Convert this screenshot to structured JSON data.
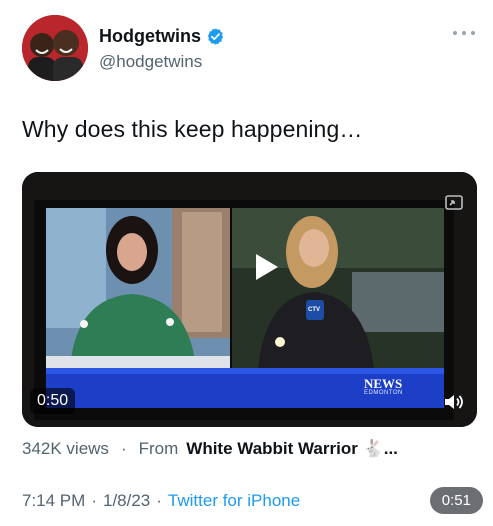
{
  "author": {
    "name": "Hodgetwins",
    "handle": "@hodgetwins",
    "verified": true
  },
  "tweet": {
    "text": "Why does this keep happening…"
  },
  "video": {
    "duration": "0:50",
    "tv_brand": "NEWS",
    "tv_sub": "EDMONTON",
    "mic_label": "CTV"
  },
  "stats": {
    "views": "342K views",
    "dot": "·",
    "from_label": "From",
    "from_name": "White Wabbit Warrior 🐇..."
  },
  "footer": {
    "time": "7:14 PM",
    "sep1": "·",
    "date": "1/8/23",
    "sep2": "·",
    "source": "Twitter for iPhone"
  },
  "floating_duration": "0:51",
  "colors": {
    "accent": "#1d9bf0",
    "secondary_text": "#536471"
  }
}
